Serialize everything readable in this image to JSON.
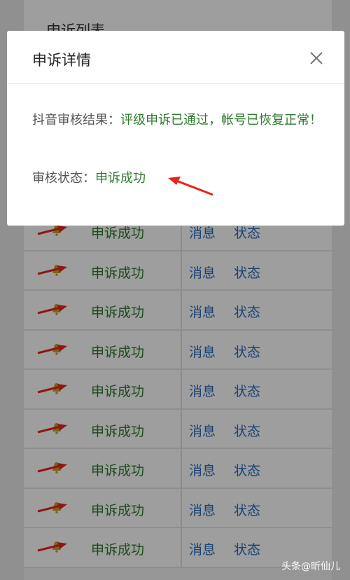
{
  "page": {
    "title": "申诉列表"
  },
  "list": {
    "rows": [
      {
        "status": "申诉成功",
        "message": "消息",
        "state": "状态"
      },
      {
        "status": "申诉成功",
        "message": "消息",
        "state": "状态"
      },
      {
        "status": "申诉成功",
        "message": "消息",
        "state": "状态"
      },
      {
        "status": "申诉成功",
        "message": "消息",
        "state": "状态"
      },
      {
        "status": "申诉成功",
        "message": "消息",
        "state": "状态"
      },
      {
        "status": "申诉成功",
        "message": "消息",
        "state": "状态"
      },
      {
        "status": "申诉成功",
        "message": "消息",
        "state": "状态"
      },
      {
        "status": "申诉成功",
        "message": "消息",
        "state": "状态"
      },
      {
        "status": "申诉成功",
        "message": "消息",
        "state": "状态"
      }
    ]
  },
  "modal": {
    "title": "申诉详情",
    "close_icon": "close-icon",
    "result_label": "抖音审核结果：",
    "result_value": "评级申诉已通过，帐号已恢复正常！",
    "status_label": "审核状态：",
    "status_value": "申诉成功"
  },
  "watermark": "头条@昕仙儿",
  "colors": {
    "success_green": "#2f7a2f",
    "link_blue": "#2a6bbf",
    "annotation_red": "#e8231f",
    "bell_gold": "#c9a227"
  }
}
